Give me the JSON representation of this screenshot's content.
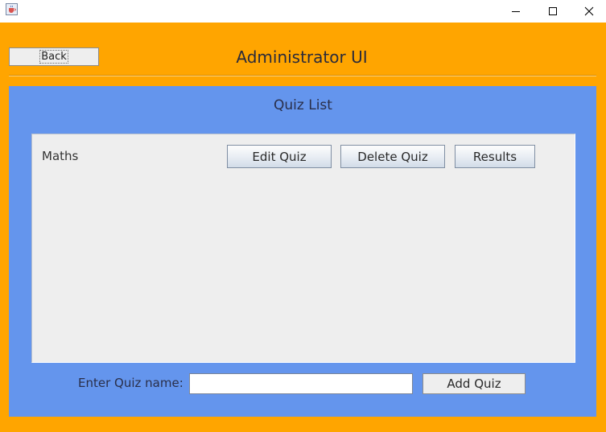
{
  "window": {
    "icon": "java-cup-icon",
    "controls": [
      "minimize-icon",
      "maximize-icon",
      "close-icon"
    ]
  },
  "header": {
    "back_label": "Back",
    "title": "Administrator UI"
  },
  "quiz_list": {
    "title": "Quiz List",
    "items": [
      {
        "name": "Maths",
        "edit_label": "Edit Quiz",
        "delete_label": "Delete Quiz",
        "results_label": "Results"
      }
    ]
  },
  "add_quiz": {
    "label": "Enter Quiz name:",
    "input_value": "",
    "button_label": "Add Quiz"
  },
  "colors": {
    "frame": "#ffa500",
    "panel": "#6495ed",
    "list_background": "#eeeeee"
  }
}
